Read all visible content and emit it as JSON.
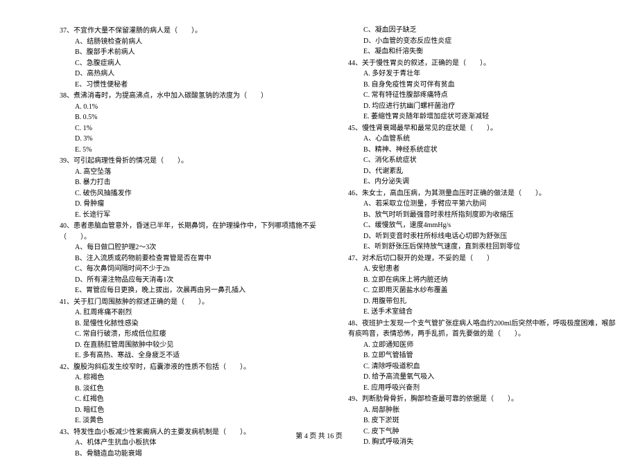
{
  "footer": "第 4 页 共 16 页",
  "left": {
    "q37": {
      "stem": "37、不宜作大量不保留灌肠的病人是（　　）。",
      "opts": [
        "A、结肠镜检查前病人",
        "B、腹部手术前病人",
        "C、急腹症病人",
        "D、高热病人",
        "E、习惯性便秘者"
      ]
    },
    "q38": {
      "stem": "38、煮沸消毒时，为提高沸点，水中加入碳酸氢钠的浓度为（　　）",
      "opts": [
        "A. 0.1%",
        "B. 0.5%",
        "C. 1%",
        "D. 3%",
        "E. 5%"
      ]
    },
    "q39": {
      "stem": "39、可引起病理性骨折的情况是（　　）。",
      "opts": [
        "A. 高空坠落",
        "B. 暴力打击",
        "C. 破伤风抽搐发作",
        "D. 骨肿瘤",
        "E. 长途行军"
      ]
    },
    "q40": {
      "stem": "40、患者患脑血管意外，昏迷已半年，长期鼻饲，在护理操作中，下列哪项措施不妥（　　）。",
      "opts": [
        "A、每日做口腔护理2～3次",
        "B、注入流质或药物前要检查胃管是否在胃中",
        "C、每次鼻饲间隔时间不少于2h",
        "D、所有灌注物品应每天消毒1次",
        "E、胃管应每日更换，晚上拔出，次晨再由另一鼻孔插入"
      ]
    },
    "q41": {
      "stem": "41、关于肛门周围脓肿的叙述正确的是（　　）。",
      "opts": [
        "A. 肛周疼痛不剧烈",
        "B. 是慢性化脓性感染",
        "C. 常自行破溃，形成低位肛瘘",
        "D. 在直肠肛管周围脓肿中较少见",
        "E. 多有高热、寒战、全身疲乏不适"
      ]
    },
    "q42": {
      "stem": "42、腹股沟斜疝发生绞窄时，疝囊渗液的性质不包括（　　）。",
      "opts": [
        "A. 棕褐色",
        "B. 淡红色",
        "C. 红褐色",
        "D. 暗红色",
        "E. 淡黄色"
      ]
    },
    "q43": {
      "stem": "43、特发性血小板减少性紫癜病人的主要发病机制是（　　）。",
      "opts": [
        "A、机体产生抗血小板抗体",
        "B、骨髓造血功能衰竭"
      ]
    }
  },
  "right": {
    "q43c": {
      "opts": [
        "C、凝血因子缺乏",
        "D、小血管的变态反应性炎症",
        "E、凝血和纤溶失衡"
      ]
    },
    "q44": {
      "stem": "44、关于慢性胃炎的叙述，正确的是（　　）。",
      "opts": [
        "A. 多好发于青壮年",
        "B. 自身免疫性胃炎可伴有贫血",
        "C. 常有特征性腹部疼痛特点",
        "D. 均应进行抗幽门螺杆菌治疗",
        "E. 萎缩性胃炎随年龄增加症状可逐渐减轻"
      ]
    },
    "q45": {
      "stem": "45、慢性肾衰竭最早和最常见的症状是（　　）。",
      "opts": [
        "A、心血管系统",
        "B、精神、神经系统症状",
        "C、消化系统症状",
        "D、代谢紊乱",
        "E、内分泌失调"
      ]
    },
    "q46": {
      "stem": "46、朱女士，高血压病，为其测量血压时正确的做法是（　　）。",
      "opts": [
        "A、若采取立位测量，手臂应平第六肋间",
        "B、放气时听到最强音时汞柱所指刻度即为收缩压",
        "C、缓慢放气，速度4mmHg/s",
        "D、听到变音时汞柱所标线电话心切即为舒张压",
        "E、听到舒张压后保持放气速度，直到汞柱回到零位"
      ]
    },
    "q47": {
      "stem": "47、对术后切口裂开的处理，不妥的是（　　）",
      "opts": [
        "A. 安慰患者",
        "B. 立即在病床上将内脏还纳",
        "C. 立即用灭菌盐水纱布覆盖",
        "D. 用腹带包扎",
        "E. 送手术室缝合"
      ]
    },
    "q48": {
      "stem": "48、夜班护士发现一个支气管扩张症病人咯血约200ml后突然中断，呼吸极度困难，喉部有痰鸣音，表情恐怖，两手乱抓，首先要做的是（　　）。",
      "opts": [
        "A. 立即通知医师",
        "B. 立即气管插管",
        "C. 清除呼吸道积血",
        "D. 给予高流量氧气吸入",
        "E. 应用呼吸兴奋剂"
      ]
    },
    "q49": {
      "stem": "49、判断肋骨骨折，胸部检查最可靠的依据是（　　）。",
      "opts": [
        "A. 局部肿胀",
        "B. 皮下淤斑",
        "C. 皮下气肿",
        "D. 胸式呼吸消失"
      ]
    }
  }
}
